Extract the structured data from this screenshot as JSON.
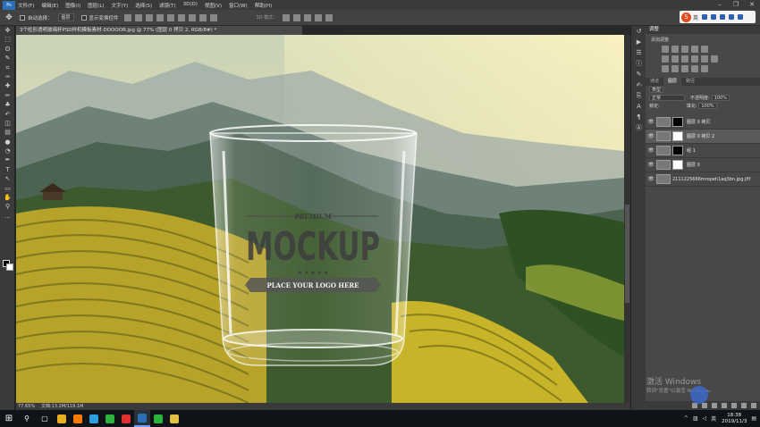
{
  "app": {
    "logo": "Ps"
  },
  "menu": [
    "文件(F)",
    "编辑(E)",
    "图像(I)",
    "图层(L)",
    "文字(Y)",
    "选择(S)",
    "滤镜(T)",
    "3D(D)",
    "视图(V)",
    "窗口(W)",
    "帮助(H)"
  ],
  "window_controls": [
    "minimize-icon",
    "maximize-icon",
    "close-icon"
  ],
  "options_bar": {
    "tool_icon": "move-icon",
    "auto_select_label": "自动选择：",
    "auto_select_value": "图层",
    "transform_label": "显示变换控件",
    "mode_3d_label": "3D 模式："
  },
  "ime": {
    "label": "英"
  },
  "toolbar": [
    "move-icon",
    "marquee-icon",
    "lasso-icon",
    "quick-select-icon",
    "crop-icon",
    "eyedropper-icon",
    "healing-icon",
    "brush-icon",
    "stamp-icon",
    "history-brush-icon",
    "eraser-icon",
    "gradient-icon",
    "blur-icon",
    "dodge-icon",
    "pen-icon",
    "type-icon",
    "path-select-icon",
    "rectangle-icon",
    "hand-icon",
    "zoom-icon",
    "more-icon"
  ],
  "toolbar_glyphs": [
    "✥",
    "⬚",
    "ʘ",
    "✎",
    "⌗",
    "✑",
    "✚",
    "✏",
    "♣",
    "↶",
    "◫",
    "▤",
    "●",
    "◔",
    "✒",
    "T",
    "↖",
    "▭",
    "✋",
    "⚲",
    "…"
  ],
  "document": {
    "tab_title": "3个柱形透明玻璃杯PSD样机模板素材-DOOOOR.jpg @ 77% (图层 0 拷贝 2, RGB/8#) *",
    "mockup_premium": "PREMIUM",
    "mockup_title": "MOCKUP",
    "mockup_stars": "★ ★ ★ ★ ★",
    "mockup_ribbon": "PLACE YOUR LOGO HERE"
  },
  "status": {
    "zoom": "77.65%",
    "doc": "文档:13.2M/119.1M"
  },
  "panels": {
    "tab_adjust": "调整",
    "adjust_title": "添加调整",
    "layer_tabs": [
      "通道",
      "图层",
      "路径"
    ],
    "filter_label": "类型",
    "blend_mode": "正常",
    "opacity_label": "不透明度:",
    "opacity_value": "100%",
    "lock_label": "锁定:",
    "fill_label": "填充:",
    "fill_value": "100%",
    "layers": [
      {
        "name": "图层 0 拷贝",
        "mask": "black",
        "selected": false
      },
      {
        "name": "图层 0 拷贝 2",
        "mask": "white",
        "selected": true
      },
      {
        "name": "组 1",
        "mask": "black",
        "selected": false
      },
      {
        "name": "图层 0",
        "mask": "white",
        "selected": false
      },
      {
        "name": "2111225666mropeh1aq3bn.jpg.jfif",
        "mask": "none",
        "selected": false
      }
    ]
  },
  "watermark": {
    "line1": "激活 Windows",
    "line2": "转到\"设置\"以激活 Windows。"
  },
  "taskbar": {
    "start_icon": "windows-icon",
    "search_icon": "search-icon",
    "apps": [
      {
        "name": "chrome-icon",
        "color": "#e8b020"
      },
      {
        "name": "illustrator-icon",
        "color": "#ff7b00"
      },
      {
        "name": "app-icon",
        "color": "#2aa0e0"
      },
      {
        "name": "app-icon",
        "color": "#2ab43c"
      },
      {
        "name": "app-icon",
        "color": "#e03030"
      },
      {
        "name": "photoshop-icon",
        "color": "#2a6fb8",
        "active": true
      },
      {
        "name": "wechat-icon",
        "color": "#2ab43c"
      },
      {
        "name": "app-icon",
        "color": "#e0c040"
      }
    ],
    "tray_lang": "英",
    "time": "18:38",
    "date": "2019/11/3"
  }
}
